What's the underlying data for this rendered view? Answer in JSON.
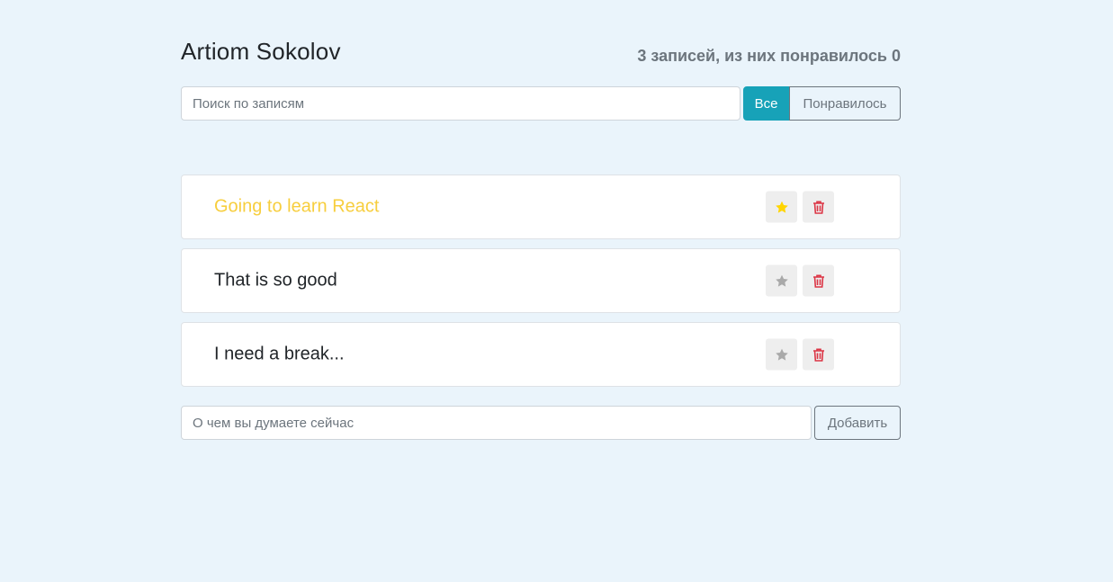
{
  "header": {
    "title": "Artiom Sokolov",
    "stats": "3 записей, из них понравилось 0"
  },
  "search": {
    "placeholder": "Поиск по записям",
    "value": ""
  },
  "filter": {
    "all_label": "Все",
    "liked_label": "Понравилось",
    "active": "all"
  },
  "posts": [
    {
      "label": "Going to learn React",
      "important": true
    },
    {
      "label": "That is so good",
      "important": false
    },
    {
      "label": "I need a break...",
      "important": false
    }
  ],
  "post_actions": {
    "star_icon": "star-icon",
    "delete_icon": "trash-icon"
  },
  "add_form": {
    "placeholder": "О чем вы думаете сейчас",
    "value": "",
    "button_label": "Добавить"
  },
  "colors": {
    "background": "#eaf4fb",
    "accent": "#17a2b8",
    "important_text": "#f7ce3e",
    "star_active": "#ffd500",
    "star_inactive": "#a9a9a9",
    "delete": "#dc3545"
  }
}
